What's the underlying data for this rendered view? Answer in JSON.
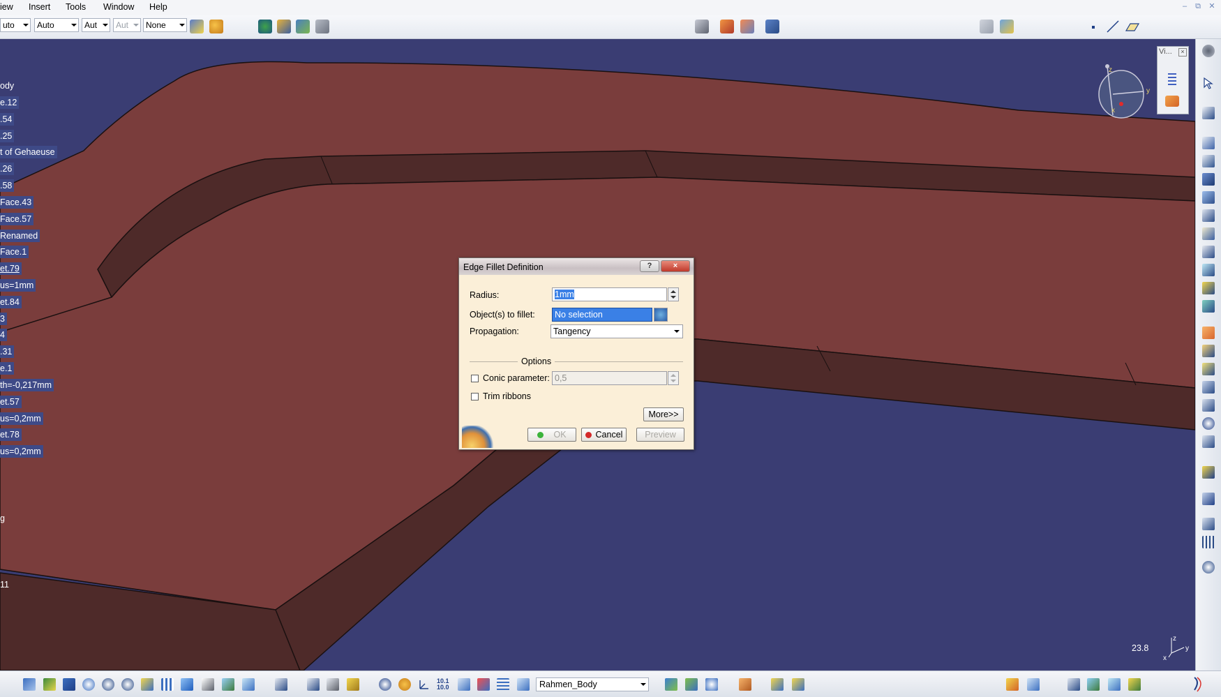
{
  "menu": {
    "items": [
      "iew",
      "Insert",
      "Tools",
      "Window",
      "Help"
    ]
  },
  "toolbar": {
    "combos": [
      {
        "value": "uto"
      },
      {
        "value": "Auto"
      },
      {
        "value": "Aut"
      },
      {
        "value": "Aut",
        "disabled": true
      },
      {
        "value": "None"
      }
    ]
  },
  "tree": {
    "items": [
      "ody",
      "e.12",
      ".54",
      ".25",
      "t of Gehaeuse",
      ".26",
      ".58",
      "Face.43",
      "Face.57",
      "Renamed",
      "Face.1",
      "et.79",
      "us=1mm",
      "et.84",
      "3",
      "4",
      ".31",
      "e.1",
      "th=-0,217mm",
      "et.57",
      "us=0,2mm",
      "et.78",
      "us=0,2mm",
      "g",
      "11"
    ]
  },
  "compass": {
    "panel_title": "Vi...",
    "axis_z": "z",
    "axis_y": "y",
    "axis_x": "x"
  },
  "viewport": {
    "scale_value": "23.8",
    "axis_z": "z",
    "axis_y": "y",
    "axis_x": "x"
  },
  "dialog": {
    "title": "Edge Fillet Definition",
    "help_label": "?",
    "close_label": "×",
    "radius_label": "Radius:",
    "radius_value": "1mm",
    "objects_label": "Object(s) to fillet:",
    "objects_value": "No selection",
    "propagation_label": "Propagation:",
    "propagation_value": "Tangency",
    "options_header": "Options",
    "conic_label": "Conic parameter:",
    "conic_value": "0,5",
    "trim_label": "Trim ribbons",
    "more_label": "More>>",
    "ok_label": "OK",
    "cancel_label": "Cancel",
    "preview_label": "Preview"
  },
  "bottom": {
    "body_selector": "Rahmen_Body"
  },
  "colors": {
    "background_3d": "#3a3d73",
    "part_face_top": "#7a3d3c",
    "part_face_side": "#4e2a29",
    "tree_highlight": "#3e4a87",
    "dialog_bg": "#fbefd8",
    "selection_blue": "#3a80e6"
  }
}
